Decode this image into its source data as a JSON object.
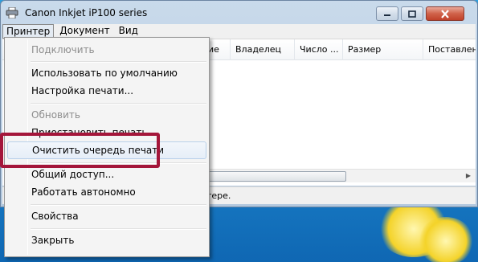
{
  "window": {
    "title": "Canon Inkjet iP100 series"
  },
  "menubar": {
    "items": [
      "Принтер",
      "Документ",
      "Вид"
    ]
  },
  "list": {
    "columns": [
      "ие",
      "Владелец",
      "Число ...",
      "Размер",
      "Поставлен"
    ]
  },
  "status": {
    "text": "тере."
  },
  "dropdown": {
    "items": [
      {
        "label": "Подключить",
        "disabled": true
      },
      {
        "label": "Использовать по умолчанию",
        "disabled": false
      },
      {
        "label": "Настройка печати...",
        "disabled": false
      },
      {
        "label": "Обновить",
        "disabled": true
      },
      {
        "label": "Приостановить печать",
        "disabled": false
      },
      {
        "label": "Очистить очередь печати",
        "disabled": false,
        "highlighted": true
      },
      {
        "label": "Общий доступ...",
        "disabled": false
      },
      {
        "label": "Работать автономно",
        "disabled": false
      },
      {
        "label": "Свойства",
        "disabled": false
      },
      {
        "label": "Закрыть",
        "disabled": false
      }
    ]
  },
  "colors": {
    "highlight_border": "#a4163a",
    "desktop": "#1a7fc8"
  }
}
